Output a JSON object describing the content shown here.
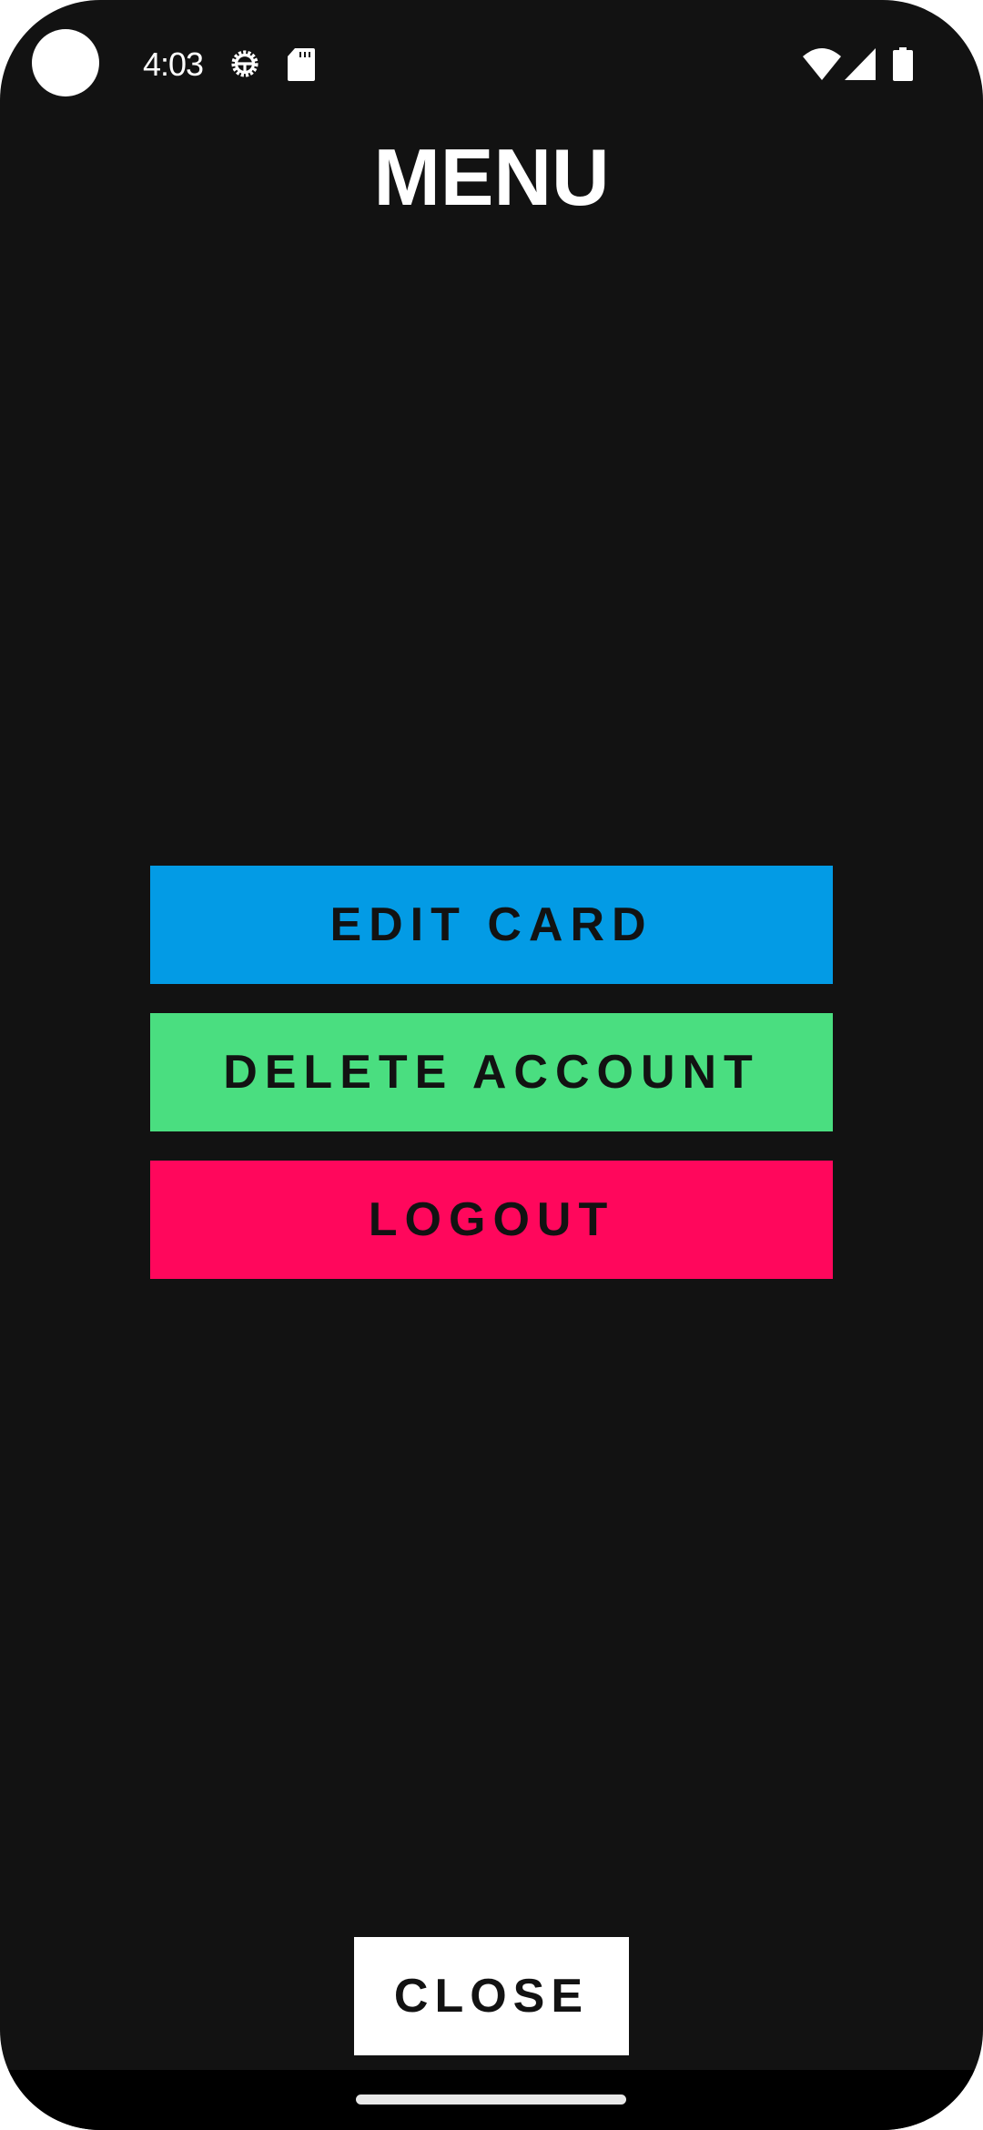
{
  "status_bar": {
    "time": "4:03",
    "icons": [
      "camera-cutout",
      "settings-gear-icon",
      "sd-card-icon",
      "wifi-icon",
      "cell-signal-icon",
      "battery-icon"
    ]
  },
  "header": {
    "title": "MENU"
  },
  "menu": {
    "items": [
      {
        "label": "EDIT CARD",
        "color": "#039BE5"
      },
      {
        "label": "DELETE ACCOUNT",
        "color": "#4ADE80"
      },
      {
        "label": "LOGOUT",
        "color": "#FF075C"
      }
    ]
  },
  "footer": {
    "close_label": "CLOSE"
  },
  "colors": {
    "background": "#121212",
    "text_dark": "#121212",
    "title": "#FFFFFF"
  }
}
